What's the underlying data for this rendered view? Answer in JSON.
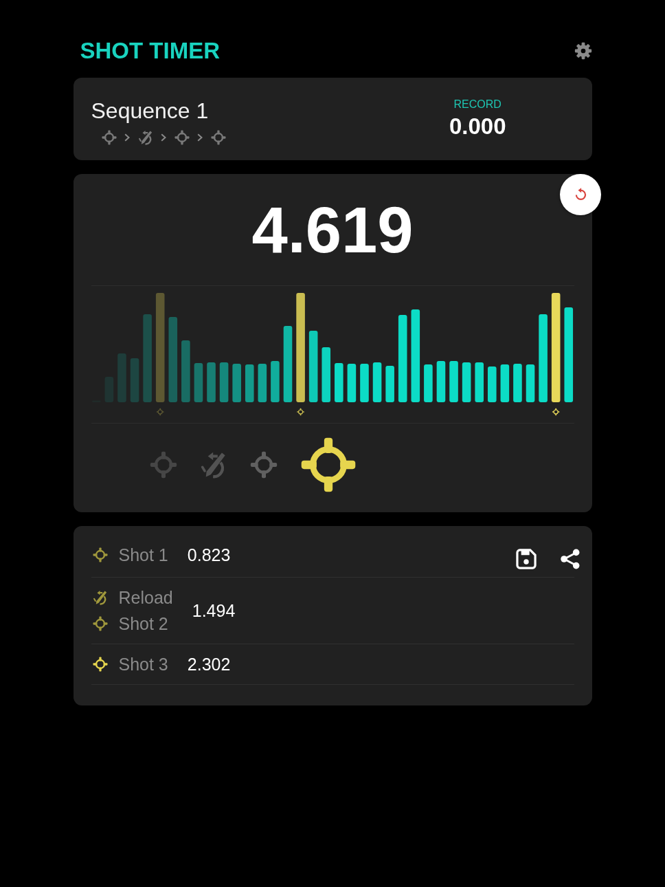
{
  "header": {
    "title": "SHOT TIMER"
  },
  "sequence": {
    "name": "Sequence 1",
    "steps": [
      {
        "kind": "shot"
      },
      {
        "kind": "reload"
      },
      {
        "kind": "shot"
      },
      {
        "kind": "shot"
      }
    ],
    "record_label": "RECORD",
    "record_time": "0.000"
  },
  "timer": {
    "time": "4.619",
    "steps": [
      {
        "kind": "shot",
        "selected": false
      },
      {
        "kind": "reload",
        "selected": false
      },
      {
        "kind": "shot",
        "selected": false
      },
      {
        "kind": "shot",
        "selected": true
      }
    ]
  },
  "splits": [
    {
      "selected": false,
      "time": "0.823",
      "events": [
        {
          "kind": "shot",
          "label": "Shot 1"
        }
      ]
    },
    {
      "selected": false,
      "time": "1.494",
      "events": [
        {
          "kind": "reload",
          "label": "Reload"
        },
        {
          "kind": "shot",
          "label": "Shot 2"
        }
      ]
    },
    {
      "selected": true,
      "time": "2.302",
      "events": [
        {
          "kind": "shot",
          "label": "Shot 3"
        }
      ]
    }
  ]
}
